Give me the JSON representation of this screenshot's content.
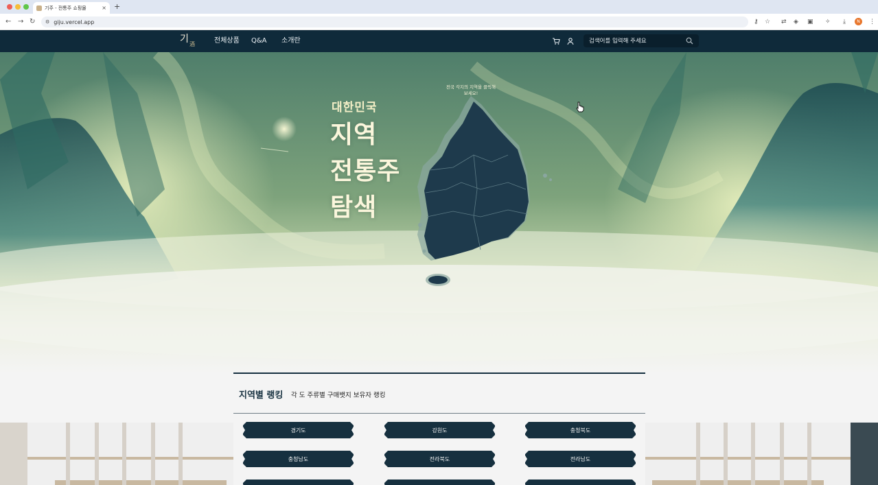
{
  "browser": {
    "tab_title": "기주 - 전통주 쇼핑몰",
    "tab_close": "×",
    "new_tab": "+",
    "url": "giju.vercel.app",
    "profile_initial": "N"
  },
  "header": {
    "logo": "기",
    "logo_sub": "酒",
    "nav": [
      "전체상품",
      "Q&A",
      "소개란"
    ],
    "search_placeholder": "검색어를 입력해 주세요",
    "icons": [
      "cart-icon",
      "user-icon",
      "search-icon"
    ]
  },
  "hero": {
    "small_title": "대한민국",
    "big_lines": [
      "지역",
      "전통주",
      "탐색"
    ],
    "map_hint": "전국 각지의 지역을 클릭해보세요!",
    "colors": {
      "map_fill": "#1e3a4c",
      "map_border": "#8aa6a0",
      "sky": "#5a8a70"
    }
  },
  "ranking": {
    "title": "지역별 랭킹",
    "subtitle": "각 도 주류별 구매뱃지 보유자 랭킹",
    "regions": [
      "경기도",
      "강원도",
      "충청북도",
      "충청남도",
      "전라북도",
      "전라남도"
    ],
    "colors": {
      "button": "#16303f",
      "line": "#16303f"
    }
  }
}
